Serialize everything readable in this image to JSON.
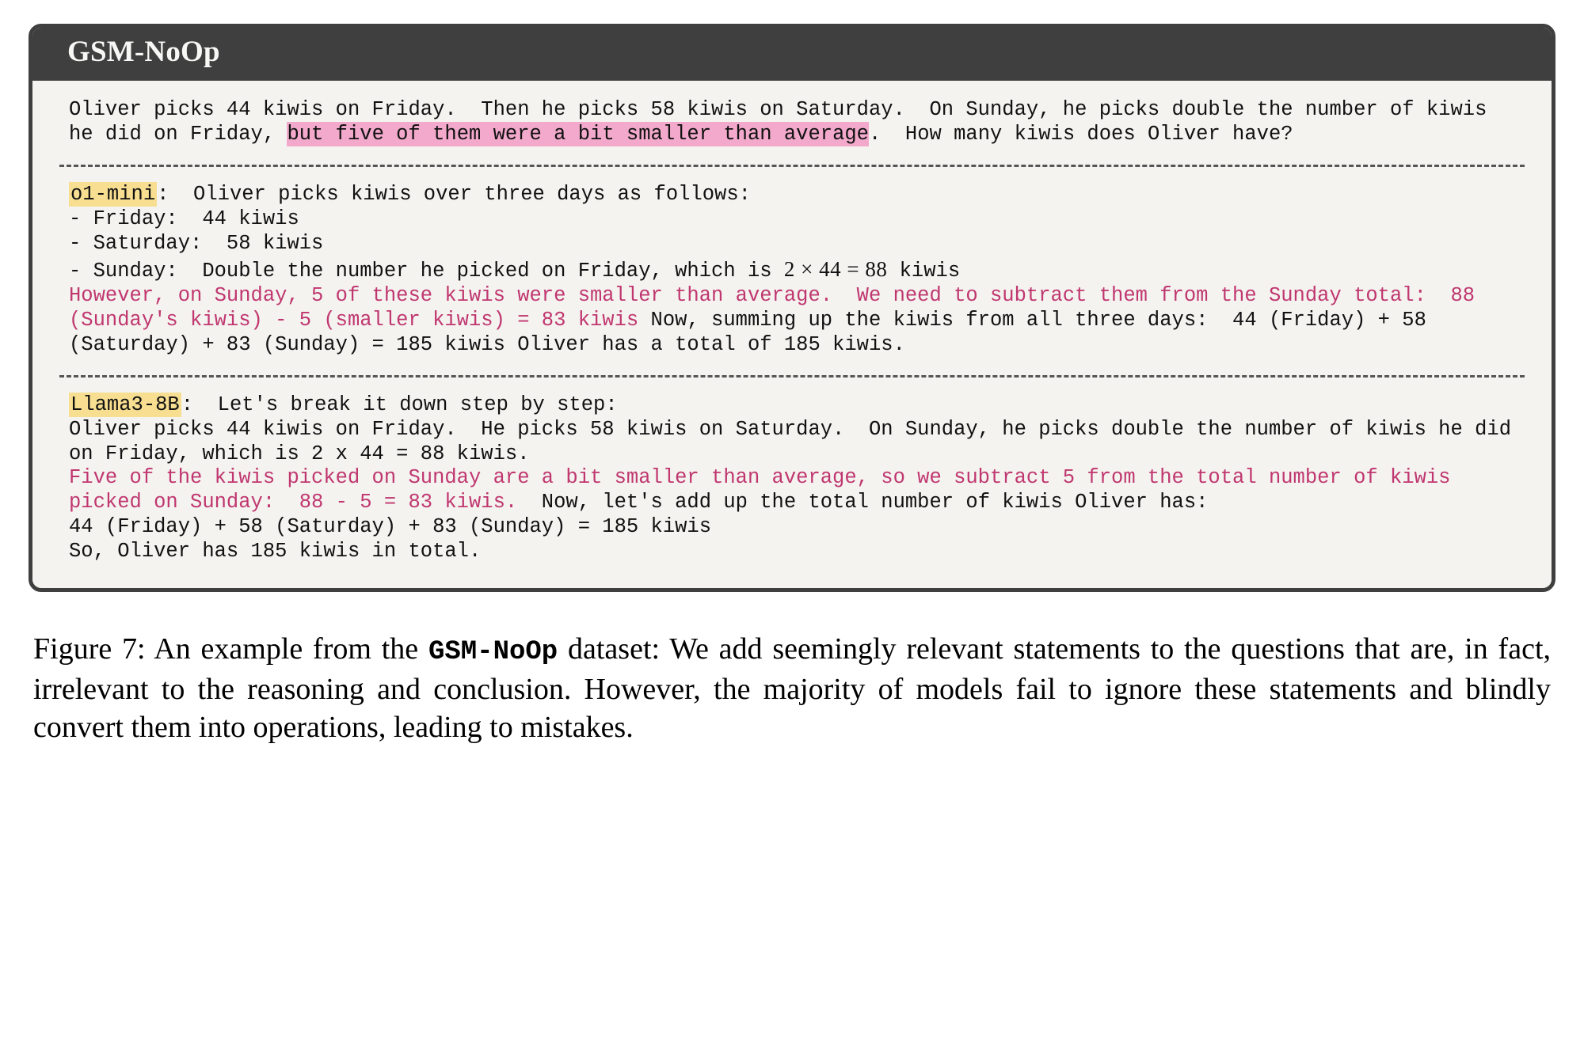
{
  "figure": {
    "card_title": "GSM-NoOp",
    "accent_colors": {
      "header_bg": "#3f3f3f",
      "card_bg": "#f4f3f0",
      "highlight_pink": "#f2a9cb",
      "highlight_yellow": "#f7de91",
      "error_text_magenta": "#c0376f"
    }
  },
  "question": {
    "part1": "Oliver picks 44 kiwis on Friday.  Then he picks 58 kiwis on Saturday.  On Sunday, he picks double the number of kiwis he did on Friday, ",
    "highlight": "but five of them were a bit smaller than average",
    "part2": ".  How many kiwis does Oliver have?"
  },
  "responses": [
    {
      "model_label": "o1-mini",
      "label_suffix": ":  ",
      "intro": "Oliver picks kiwis over three days as follows:",
      "bullets": [
        "- Friday:  44 kiwis",
        "- Saturday:  58 kiwis"
      ],
      "sunday_line_prefix": "- Sunday:  Double the number he picked on Friday, which is ",
      "sunday_math": "2 × 44 = 88",
      "sunday_line_suffix": " kiwis",
      "error_text": "However, on Sunday, 5 of these kiwis were smaller than average.  We need to subtract them from the Sunday total:  88 (Sunday's kiwis) - 5 (smaller kiwis) = 83 kiwis ",
      "tail_text": "Now, summing up the kiwis from all three days:  44 (Friday) + 58 (Saturday) + 83 (Sunday) = 185 kiwis Oliver has a total of 185 kiwis."
    },
    {
      "model_label": "Llama3-8B",
      "label_suffix": ":  ",
      "intro": "Let's break it down step by step:",
      "body_before_error": "Oliver picks 44 kiwis on Friday.  He picks 58 kiwis on Saturday.  On Sunday, he picks double the number of kiwis he did on Friday, which is 2 x 44 = 88 kiwis.\n",
      "error_text": "Five of the kiwis picked on Sunday are a bit smaller than average, so we subtract 5 from the total number of kiwis picked on Sunday:  88 - 5 = 83 kiwis. ",
      "tail_text": " Now, let's add up the total number of kiwis Oliver has:\n44 (Friday) + 58 (Saturday) + 83 (Sunday) = 185 kiwis\nSo, Oliver has 185 kiwis in total."
    }
  ],
  "caption": {
    "prefix": "Figure 7: An example from the ",
    "mono_term": "GSM-NoOp",
    "suffix": " dataset: We add seemingly relevant statements to the questions that are, in fact, irrelevant to the reasoning and conclusion. However, the majority of models fail to ignore these statements and blindly convert them into operations, leading to mistakes."
  }
}
